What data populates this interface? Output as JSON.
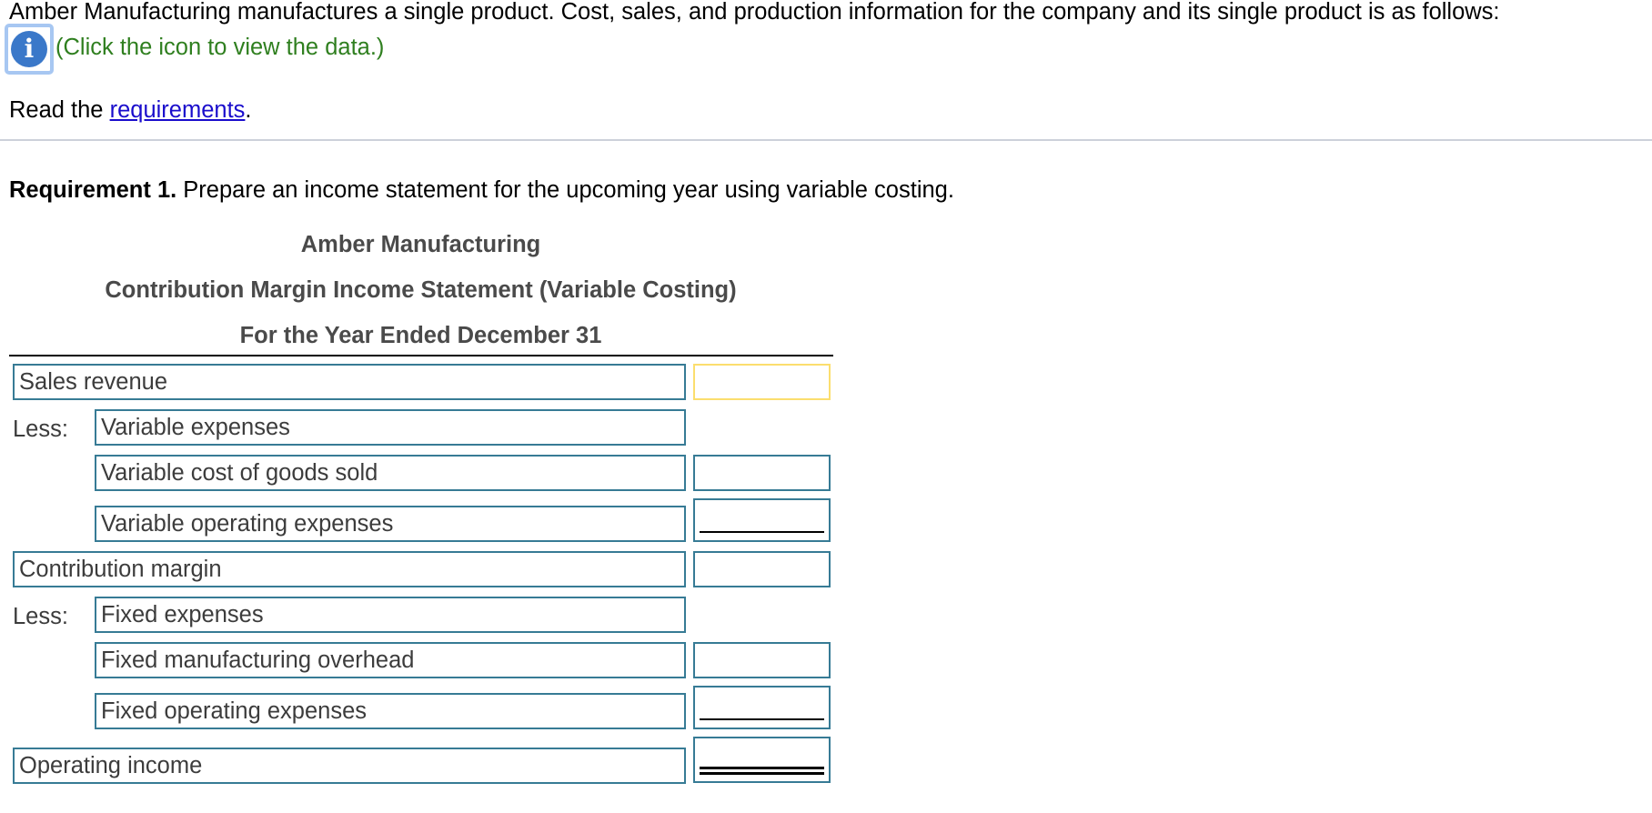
{
  "intro": {
    "text": "Amber Manufacturing manufactures a single product. Cost, sales, and production information for the company and its single product is as follows:",
    "info_icon": "info-icon",
    "click_hint": "(Click the icon to view the data.)",
    "read_prefix": "Read the ",
    "requirements_link": "requirements",
    "read_suffix": "."
  },
  "requirement": {
    "label": "Requirement 1.",
    "text": " Prepare an income statement for the upcoming year using variable costing."
  },
  "statement": {
    "company": "Amber Manufacturing",
    "title": "Contribution Margin Income Statement (Variable Costing)",
    "period": "For the Year Ended December 31",
    "less_label": "Less:",
    "rows": [
      {
        "label": "Sales revenue",
        "amount": ""
      },
      {
        "label": "Variable expenses"
      },
      {
        "label": "Variable cost of goods sold",
        "amount": ""
      },
      {
        "label": "Variable operating expenses",
        "amount": ""
      },
      {
        "label": "Contribution margin",
        "amount": ""
      },
      {
        "label": "Fixed expenses"
      },
      {
        "label": "Fixed manufacturing overhead",
        "amount": ""
      },
      {
        "label": "Fixed operating expenses",
        "amount": ""
      },
      {
        "label": "Operating income",
        "amount": ""
      }
    ]
  },
  "colors": {
    "field_border": "#377b95",
    "focused_border": "#fbde6e",
    "hint_green": "#2f7f1f",
    "link_blue": "#1a0dcc",
    "info_blue": "#3a78c9"
  }
}
